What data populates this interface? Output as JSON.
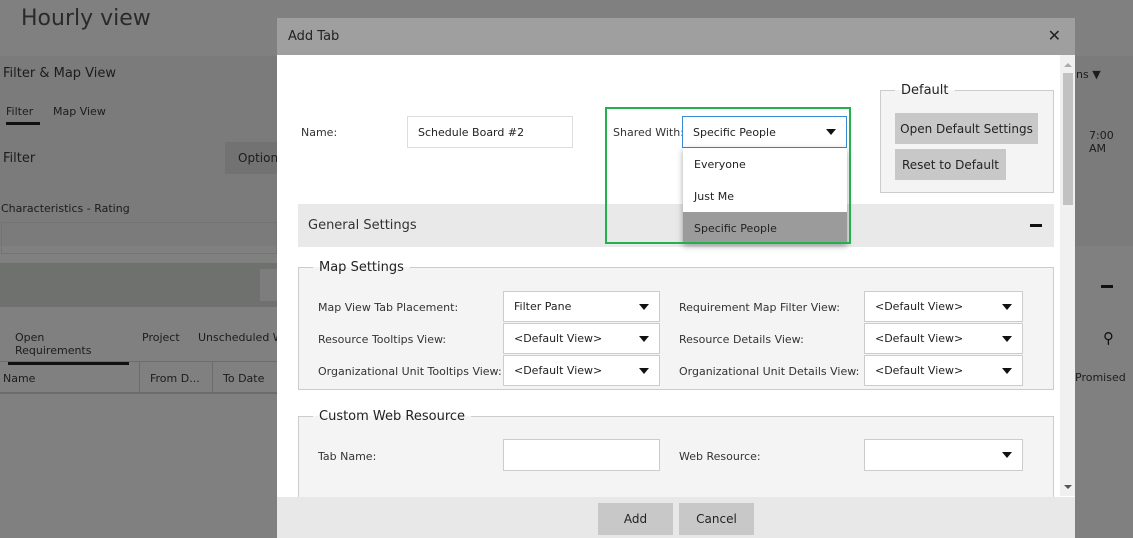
{
  "background": {
    "title": "Hourly view",
    "filter_map_view": "Filter & Map View",
    "tabs": [
      "Filter",
      "Map View"
    ],
    "filter_label": "Filter",
    "options_button": "Option",
    "characteristics_label": "Characteristics - Rating",
    "bottom_tabs": [
      "Open Requirements",
      "Project",
      "Unscheduled W"
    ],
    "columns": [
      "Name",
      "From D...",
      "To Date"
    ],
    "right_menu": "ns",
    "time": "7:00 AM",
    "promised": "Promised"
  },
  "modal": {
    "title": "Add Tab",
    "name_label": "Name:",
    "name_value": "Schedule Board #2",
    "shared_label": "Shared With:",
    "shared_value": "Specific People",
    "shared_options": [
      "Everyone",
      "Just Me",
      "Specific People"
    ],
    "highlight_color": "#22b14c",
    "default_legend": "Default",
    "open_default": "Open Default Settings",
    "reset_default": "Reset to Default",
    "general_settings": "General Settings",
    "map_settings": {
      "legend": "Map Settings",
      "rows": [
        {
          "l1": "Map View Tab Placement:",
          "v1": "Filter Pane",
          "l2": "Requirement Map Filter View:",
          "v2": "<Default View>"
        },
        {
          "l1": "Resource Tooltips View:",
          "v1": "<Default View>",
          "l2": "Resource Details View:",
          "v2": "<Default View>"
        },
        {
          "l1": "Organizational Unit Tooltips View:",
          "v1": "<Default View>",
          "l2": "Organizational Unit Details View:",
          "v2": "<Default View>"
        }
      ]
    },
    "custom_web": {
      "legend": "Custom Web Resource",
      "tab_name": "Tab Name:",
      "tab_name_value": "",
      "web_resource": "Web Resource:",
      "web_resource_value": ""
    },
    "add": "Add",
    "cancel": "Cancel"
  }
}
